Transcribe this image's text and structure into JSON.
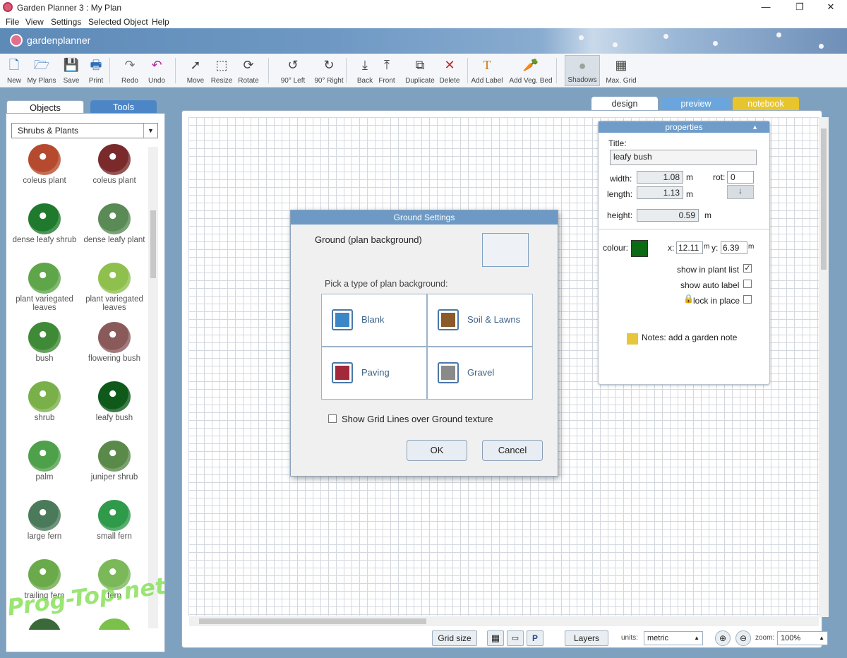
{
  "window": {
    "title": "Garden Planner 3 : My  Plan",
    "minimize": "—",
    "maximize": "❐",
    "close": "✕"
  },
  "menu": [
    "File",
    "View",
    "Settings",
    "Selected Object",
    "Help"
  ],
  "brand": {
    "name": "gardenplanner"
  },
  "toolbar": [
    {
      "label": "New",
      "icon": "new-file-icon",
      "glyph": "🗋"
    },
    {
      "label": "My Plans",
      "icon": "open-folder-icon",
      "glyph": "🗁"
    },
    {
      "label": "Save",
      "icon": "save-disk-icon",
      "glyph": "💾"
    },
    {
      "label": "Print",
      "icon": "printer-icon",
      "glyph": "🖶"
    },
    {
      "label": "Redo",
      "icon": "redo-icon",
      "glyph": "↷"
    },
    {
      "label": "Undo",
      "icon": "undo-icon",
      "glyph": "↶"
    },
    {
      "label": "Move",
      "icon": "move-arrow-icon",
      "glyph": "➚"
    },
    {
      "label": "Resize",
      "icon": "resize-icon",
      "glyph": "⬚"
    },
    {
      "label": "Rotate",
      "icon": "rotate-icon",
      "glyph": "⟳"
    },
    {
      "label": "90° Left",
      "icon": "rotate-left-icon",
      "glyph": "↺"
    },
    {
      "label": "90° Right",
      "icon": "rotate-right-icon",
      "glyph": "↻"
    },
    {
      "label": "Back",
      "icon": "send-back-icon",
      "glyph": "⤓"
    },
    {
      "label": "Front",
      "icon": "bring-front-icon",
      "glyph": "⤒"
    },
    {
      "label": "Duplicate",
      "icon": "duplicate-icon",
      "glyph": "⧉"
    },
    {
      "label": "Delete",
      "icon": "delete-x-icon",
      "glyph": "✕"
    },
    {
      "label": "Add Label",
      "icon": "text-label-icon",
      "glyph": "T"
    },
    {
      "label": "Add Veg. Bed",
      "icon": "veg-bed-icon",
      "glyph": "🥕"
    },
    {
      "label": "Shadows",
      "icon": "shadows-icon",
      "glyph": "●"
    },
    {
      "label": "Max. Grid",
      "icon": "max-grid-icon",
      "glyph": "▦"
    }
  ],
  "left_tabs": {
    "objects": "Objects",
    "tools": "Tools"
  },
  "category": {
    "selected": "Shrubs & Plants"
  },
  "plants": [
    {
      "name": "coleus plant",
      "color": "#b64a2e"
    },
    {
      "name": "coleus plant",
      "color": "#7a2a2a"
    },
    {
      "name": "dense leafy shrub",
      "color": "#1f7a2e"
    },
    {
      "name": "dense leafy plant",
      "color": "#5a8a55"
    },
    {
      "name": "plant variegated leaves",
      "color": "#5fa64a"
    },
    {
      "name": "plant variegated leaves",
      "color": "#8fc04e"
    },
    {
      "name": "bush",
      "color": "#3f8a36"
    },
    {
      "name": "flowering bush",
      "color": "#8a5a5a"
    },
    {
      "name": "shrub",
      "color": "#7ab04a"
    },
    {
      "name": "leafy bush",
      "color": "#0f5a1a"
    },
    {
      "name": "palm",
      "color": "#4fa04a"
    },
    {
      "name": "juniper shrub",
      "color": "#5a8a4a"
    },
    {
      "name": "large fern",
      "color": "#4a7a5a"
    },
    {
      "name": "small fern",
      "color": "#2f9a4a"
    },
    {
      "name": "trailing fern",
      "color": "#6aaa4a"
    },
    {
      "name": "fern",
      "color": "#7ab85a"
    }
  ],
  "view_tabs": {
    "design": "design",
    "preview": "preview",
    "notebook": "notebook"
  },
  "properties": {
    "header": "properties",
    "title_label": "Title:",
    "title_value": "leafy bush",
    "width_label": "width:",
    "width_value": "1.08",
    "width_unit": "m",
    "length_label": "length:",
    "length_value": "1.13",
    "length_unit": "m",
    "height_label": "height:",
    "height_value": "0.59",
    "height_unit": "m",
    "rot_label": "rot:",
    "rot_value": "0",
    "colour_label": "colour:",
    "colour_value": "#0b6b14",
    "x_label": "x:",
    "x_value": "12.11",
    "x_unit": "m",
    "y_label": "y:",
    "y_value": "6.39",
    "y_unit": "m",
    "show_in_plant_list": "show in plant list",
    "show_auto_label": "show auto label",
    "lock_in_place": "lock in place",
    "notes": "Notes: add a garden note",
    "checks": {
      "plant_list": true,
      "auto_label": false,
      "lock": false
    }
  },
  "dialog": {
    "title": "Ground Settings",
    "ground_label": "Ground (plan background)",
    "pick_label": "Pick a type of plan background:",
    "options": [
      {
        "label": "Blank",
        "color": "#3a86c6"
      },
      {
        "label": "Soil & Lawns",
        "color": "#8a5a2a"
      },
      {
        "label": "Paving",
        "color": "#a2283a"
      },
      {
        "label": "Gravel",
        "color": "#8a8a8a"
      }
    ],
    "gridlines_label": "Show Grid Lines over Ground texture",
    "gridlines_checked": false,
    "ok": "OK",
    "cancel": "Cancel"
  },
  "statusbar": {
    "grid_size": "Grid size",
    "layers": "Layers",
    "units_label": "units:",
    "units_value": "metric",
    "zoom_label": "zoom:",
    "zoom_value": "100%"
  },
  "watermark": "Prog-Top.net"
}
